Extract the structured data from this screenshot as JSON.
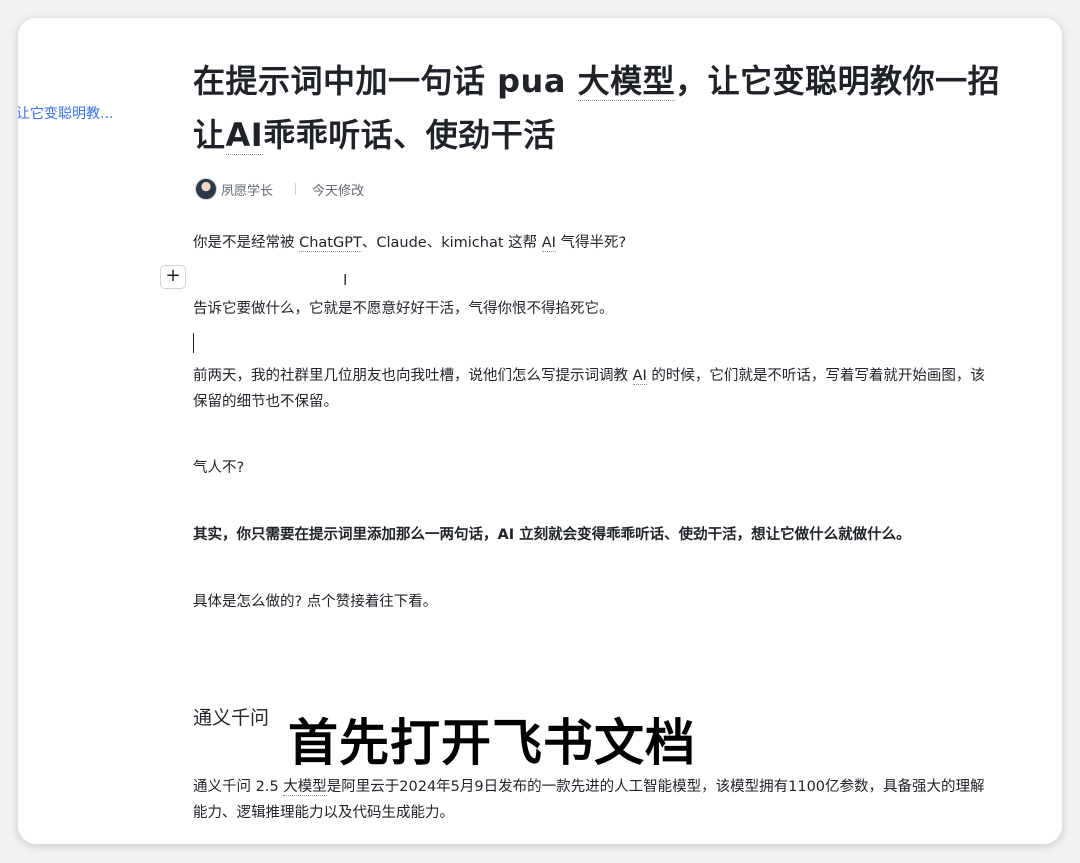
{
  "toc": {
    "link": "让它变聪明教..."
  },
  "doc": {
    "title_line1_a": "在提示词中加一句话 pua ",
    "title_line1_b": "大模型",
    "title_line1_c": "，让它变聪明教你一招",
    "title_line2_a": "让",
    "title_line2_b": "AI",
    "title_line2_c": "乖乖听话、使劲干活",
    "author": "夙愿学长",
    "modified": "今天修改",
    "p1_a": "你是不是经常被 ",
    "p1_b": "ChatGPT",
    "p1_c": "、Claude、kimichat 这帮 ",
    "p1_d": "AI",
    "p1_e": " 气得半死?",
    "p2": "告诉它要做什么，它就是不愿意好好干活，气得你恨不得掐死它。",
    "p3_a": "前两天，我的社群里几位朋友也向我吐槽，说他们怎么写提示词调教 ",
    "p3_b": "AI",
    "p3_c": " 的时候，它们就是不听话，写着写着就开始画图，该保留的细节也不保留。",
    "p4": "气人不?",
    "p5": "其实，你只需要在提示词里添加那么一两句话，AI 立刻就会变得乖乖听话、使劲干活，想让它做什么就做什么。",
    "p6": "具体是怎么做的? 点个赞接着往下看。",
    "h2": "通义千问",
    "p7_a": "通义千问 2.5 ",
    "p7_b": "大模型",
    "p7_c": "是阿里云于2024年5月9日发布的一款先进的人工智能模型，该模型拥有1100亿参数，具备强大的理解能力、逻辑推理能力以及代码生成能力。"
  },
  "editor": {
    "plus_label": "+",
    "ibeam": "I"
  },
  "caption": "首先打开飞书文档"
}
